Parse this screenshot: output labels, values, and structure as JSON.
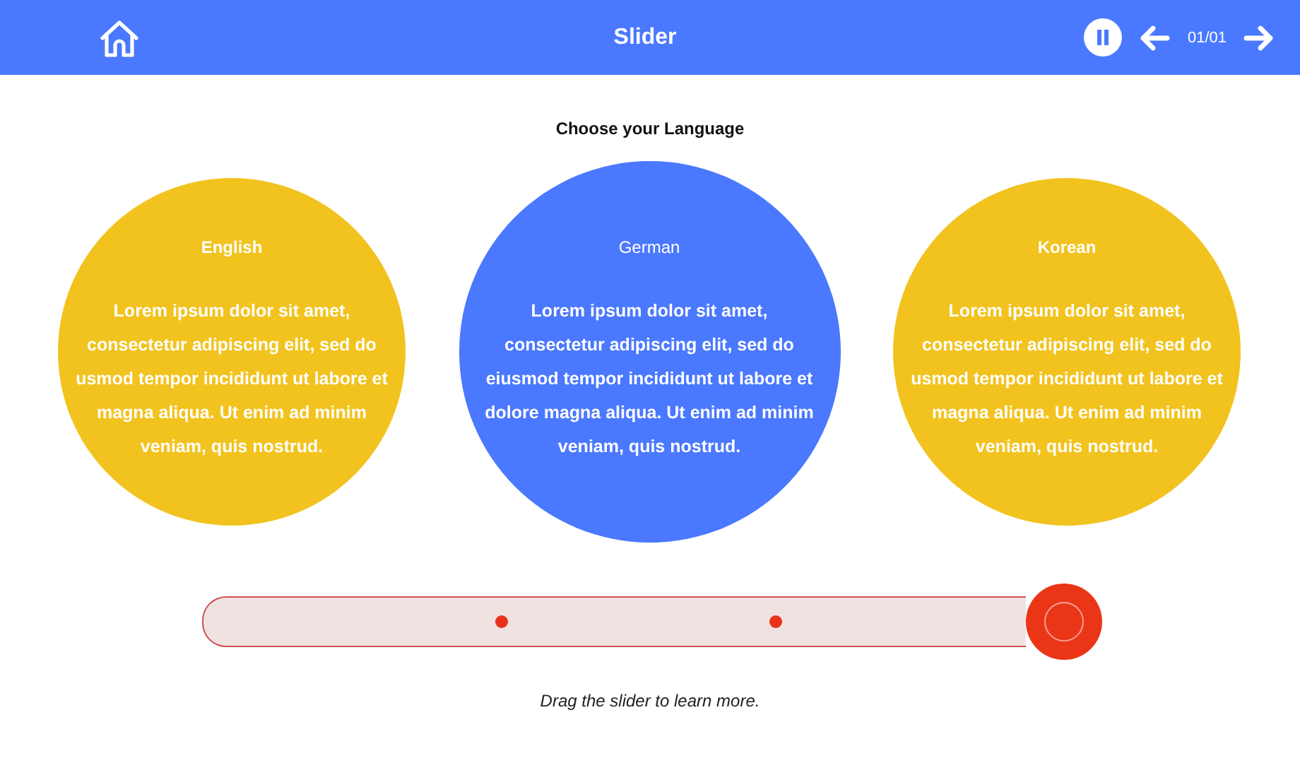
{
  "header": {
    "title": "Slider",
    "counter": "01/01"
  },
  "heading": "Choose your Language",
  "cards": [
    {
      "title": "English",
      "body": "Lorem ipsum dolor sit amet, consectetur adipiscing elit, sed do usmod tempor incididunt ut labore et magna aliqua. Ut enim ad minim veniam, quis nostrud.",
      "selected": false
    },
    {
      "title": "German",
      "body": "Lorem ipsum dolor sit amet, consectetur adipiscing elit, sed do eiusmod tempor incididunt ut labore et dolore magna aliqua. Ut enim ad minim veniam, quis nostrud.",
      "selected": true
    },
    {
      "title": "Korean",
      "body": "Lorem ipsum dolor sit amet, consectetur adipiscing elit, sed do usmod tempor incididunt ut labore et magna aliqua. Ut enim ad minim veniam, quis nostrud.",
      "selected": false
    }
  ],
  "caption": "Drag the slider to learn more."
}
